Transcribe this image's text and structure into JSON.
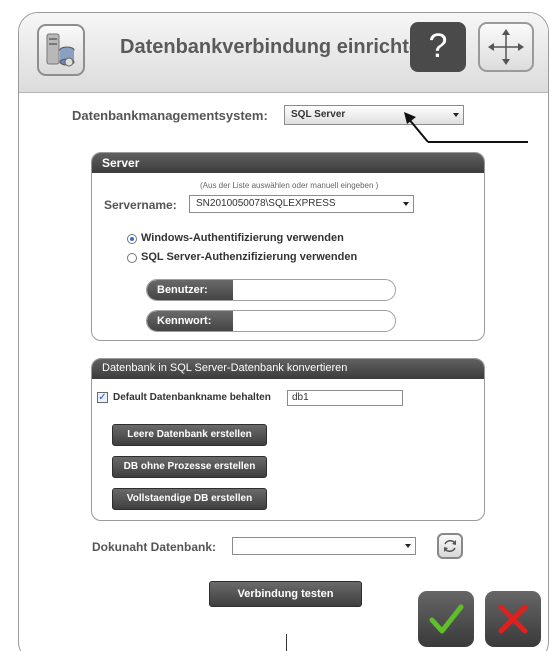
{
  "dialog": {
    "title": "Datenbankverbindung einrichten",
    "help_label": "?"
  },
  "dbms": {
    "label": "Datenbankmanagementsystem:",
    "selected": "SQL Server"
  },
  "server_panel": {
    "header": "Server",
    "hint": "(Aus der Liste auswählen oder manuell eingeben )",
    "servername_label": "Servername:",
    "servername_value": "SN2010050078\\SQLEXPRESS",
    "auth_windows": "Windows-Authentifizierung verwenden",
    "auth_sql": "SQL Server-Authenzifizierung verwenden",
    "auth_selected": "windows",
    "user_label": "Benutzer:",
    "user_value": "",
    "password_label": "Kennwort:",
    "password_value": ""
  },
  "convert_panel": {
    "header": "Datenbank in SQL Server-Datenbank konvertieren",
    "keep_default_label": "Default Datenbankname behalten",
    "keep_default_checked": true,
    "db_name_value": "db1",
    "btn_empty": "Leere Datenbank erstellen",
    "btn_no_procs": "DB ohne Prozesse erstellen",
    "btn_full": "Vollstaendige DB erstellen"
  },
  "doku": {
    "label": "Dokunaht Datenbank:",
    "value": ""
  },
  "footer": {
    "test_button": "Verbindung testen"
  },
  "colors": {
    "ok_check": "#5fbf2a",
    "cancel_x": "#e02020",
    "panel_header": "#444444"
  }
}
